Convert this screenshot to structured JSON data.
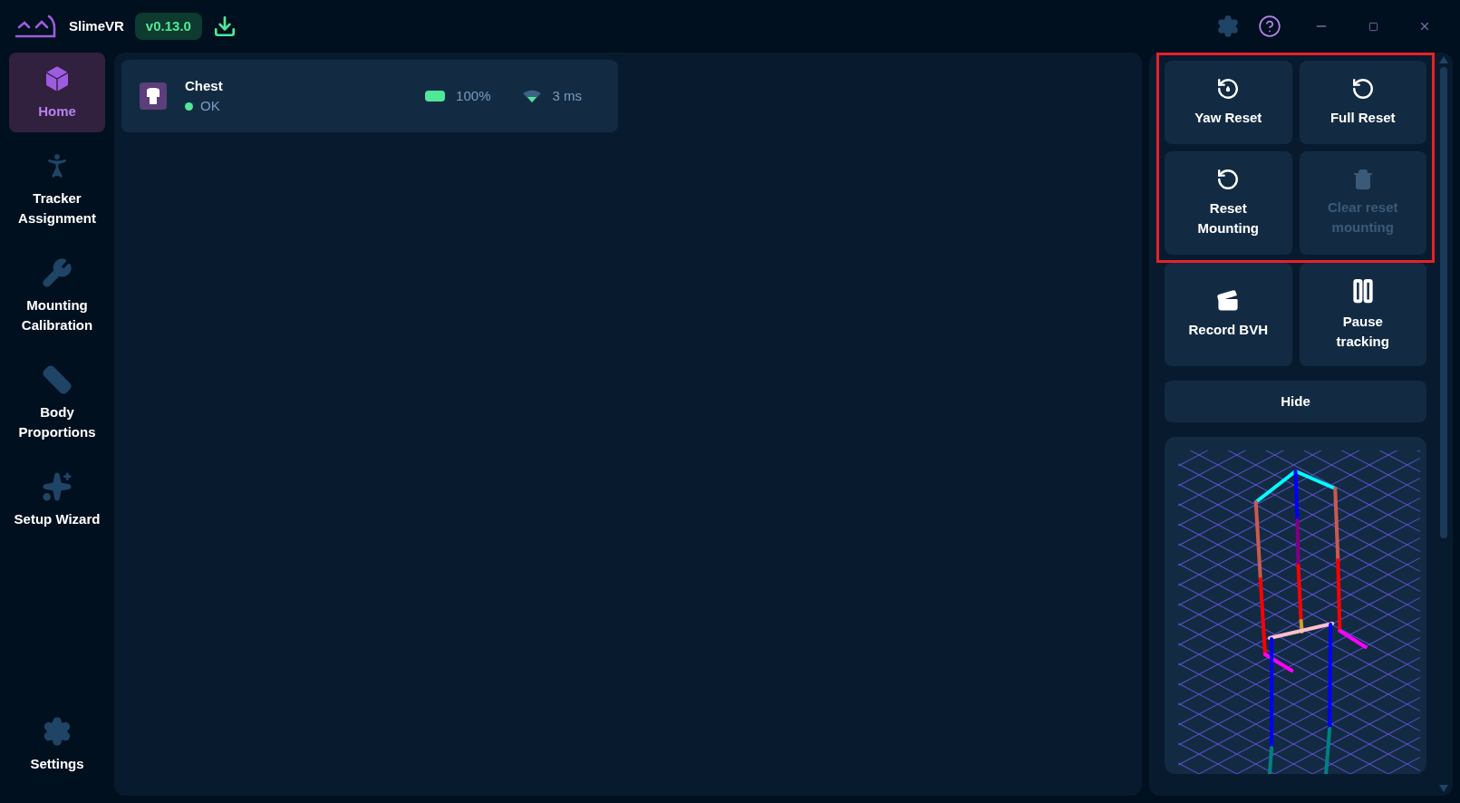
{
  "app": {
    "name": "SlimeVR",
    "version": "v0.13.0"
  },
  "sidebar": {
    "items": [
      {
        "label": "Home",
        "kind": "home",
        "selected": true
      },
      {
        "label": "Tracker Assignment",
        "kind": "assignment",
        "selected": false
      },
      {
        "label": "Mounting Calibration",
        "kind": "mounting",
        "selected": false
      },
      {
        "label": "Body Proportions",
        "kind": "proportions",
        "selected": false
      },
      {
        "label": "Setup Wizard",
        "kind": "wizard",
        "selected": false
      }
    ],
    "footer": {
      "label": "Settings",
      "kind": "settings",
      "selected": false
    }
  },
  "trackers": [
    {
      "name": "Chest",
      "status": "OK",
      "color": "#50e897",
      "battery": "100%",
      "level": 1,
      "ping": "3 ms"
    }
  ],
  "reset_group": {
    "highlighted": true,
    "buttons": [
      {
        "label": "Yaw Reset",
        "kind": "yaw",
        "disabled": false
      },
      {
        "label": "Full Reset",
        "kind": "full",
        "disabled": false
      },
      {
        "label": "Reset Mounting",
        "kind": "mounting",
        "disabled": false
      },
      {
        "label": "Clear reset mounting",
        "kind": "clear",
        "disabled": true
      }
    ]
  },
  "other_buttons": [
    {
      "label": "Record BVH",
      "kind": "record",
      "disabled": false
    },
    {
      "label": "Pause tracking",
      "kind": "pause",
      "disabled": false
    }
  ],
  "hide_button": {
    "label": "Hide"
  }
}
